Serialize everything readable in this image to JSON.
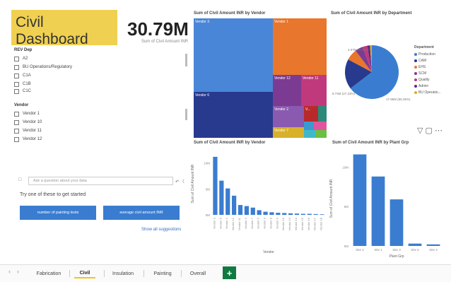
{
  "title_card": {
    "text": "Civil Dashboard"
  },
  "kpi": {
    "value": "30.79M",
    "label": "Sum of Civil Amount INR"
  },
  "slicers": {
    "rev_dep": {
      "header": "REV Dep",
      "items": [
        "A2",
        "BU Operations/Regulatory",
        "C1A",
        "C1B",
        "C1C"
      ]
    },
    "vendor": {
      "header": "Vendor",
      "items": [
        "Vendor 1",
        "Vendor 10",
        "Vendor 11",
        "Vendor 12"
      ]
    }
  },
  "qna": {
    "placeholder": "Ask a question about your data",
    "note": "Try one of these to get started",
    "suggestions": [
      "number of painting tests",
      "average civil amount INR"
    ],
    "show_all": "Show all suggestions"
  },
  "treemap": {
    "title": "Sum of Civil Amount INR by Vendor",
    "tiles": [
      {
        "label": "Vendor 3",
        "color": "#4a86d8"
      },
      {
        "label": "Vendor 1",
        "color": "#e8762c"
      },
      {
        "label": "Vendor 6",
        "color": "#283a8e"
      },
      {
        "label": "Vendor 12",
        "color": "#7b3b92"
      },
      {
        "label": "Vendor 11",
        "color": "#c0397c"
      },
      {
        "label": "Vendor 2",
        "color": "#8a5ab0"
      },
      {
        "label": "V...",
        "color": "#b82a2a"
      },
      {
        "label": "",
        "color": "#2b8a7a"
      },
      {
        "label": "Vendor 7",
        "color": "#d8b02a"
      },
      {
        "label": "",
        "color": "#3a9ad0"
      },
      {
        "label": "",
        "color": "#e055a0"
      },
      {
        "label": "",
        "color": "#40b8c8"
      },
      {
        "label": "",
        "color": "#6ac040"
      }
    ]
  },
  "pie": {
    "title": "Sum of Civil Amount INR by Department",
    "legend_title": "Department",
    "items": [
      {
        "name": "Production",
        "color": "#3a7dd0"
      },
      {
        "name": "CAM",
        "color": "#283a8e"
      },
      {
        "name": "EHS",
        "color": "#e8762c"
      },
      {
        "name": "SCM",
        "color": "#7b3b92"
      },
      {
        "name": "Quality",
        "color": "#c0397c"
      },
      {
        "name": "Admin",
        "color": "#5a2a8e"
      },
      {
        "name": "BU Operatio...",
        "color": "#d8b02a"
      }
    ],
    "data_labels": [
      "2.07M (6.72%)",
      "8.74M (27.23%)",
      "17.96M (58.35%)"
    ]
  },
  "chart_data": [
    {
      "type": "bar",
      "title": "Sum of Civil Amount INR by Vendor",
      "xlabel": "Vendor",
      "ylabel": "Sum of Civil Amount INR",
      "yticks": [
        "10M",
        "5M",
        "0M"
      ],
      "ylim": [
        0,
        12
      ],
      "categories": [
        "Vendor 3",
        "Vendor 6",
        "Vendor 1",
        "Vendor 12",
        "Vendor 11",
        "Vendor 2",
        "Vendor 7",
        "Vendor 5",
        "Vendor 4",
        "Vendor 8",
        "Vendor 9",
        "Vendor 10",
        "Vendor 13",
        "Vendor 14",
        "Vendor 15",
        "Vendor 16",
        "Vendor 17",
        "Vendor 18"
      ],
      "values": [
        11.2,
        6.6,
        5.1,
        3.7,
        1.9,
        1.7,
        1.4,
        0.9,
        0.6,
        0.5,
        0.4,
        0.35,
        0.3,
        0.25,
        0.2,
        0.2,
        0.15,
        0.1
      ]
    },
    {
      "type": "bar",
      "title": "Sum of Civil Amount INR by Plant Grp",
      "xlabel": "Plant Grp",
      "ylabel": "Sum of Civil Amount INR",
      "yticks": [
        "10M",
        "5M",
        "0M"
      ],
      "ylim": [
        0,
        12
      ],
      "categories": [
        "Site 2",
        "Site 1",
        "Site 3",
        "Site 5",
        "Site 4"
      ],
      "values": [
        11.6,
        8.8,
        5.9,
        0.3,
        0.2
      ]
    }
  ],
  "tabs": {
    "items": [
      "Fabrication",
      "Civil",
      "Insulation",
      "Painting",
      "Overall"
    ],
    "active": "Civil",
    "add_label": "+"
  }
}
